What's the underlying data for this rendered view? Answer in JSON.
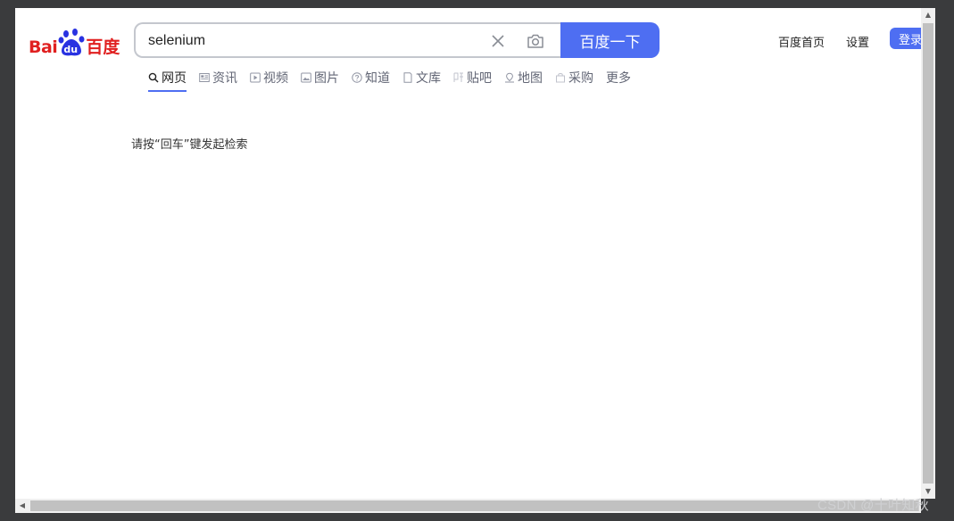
{
  "logo": {
    "latin": "Bai",
    "paw_letters": "du",
    "chinese": "百度"
  },
  "search": {
    "value": "selenium",
    "button_label": "百度一下"
  },
  "header_links": {
    "home": "百度首页",
    "settings": "设置",
    "login": "登录"
  },
  "tabs": [
    {
      "label": "网页",
      "icon": "search-icon",
      "active": true
    },
    {
      "label": "资讯",
      "icon": "news-icon"
    },
    {
      "label": "视频",
      "icon": "video-icon"
    },
    {
      "label": "图片",
      "icon": "image-icon"
    },
    {
      "label": "知道",
      "icon": "question-icon"
    },
    {
      "label": "文库",
      "icon": "document-icon"
    },
    {
      "label": "贴吧",
      "icon": "tieba-icon"
    },
    {
      "label": "地图",
      "icon": "map-icon"
    },
    {
      "label": "采购",
      "icon": "shopping-icon"
    },
    {
      "label": "更多"
    }
  ],
  "hint": "请按“回车”键发起检索",
  "watermark": "CSDN @十叶知秋",
  "colors": {
    "brand_blue": "#4e6ef2",
    "logo_red": "#e02020",
    "logo_blue": "#2932e1"
  }
}
